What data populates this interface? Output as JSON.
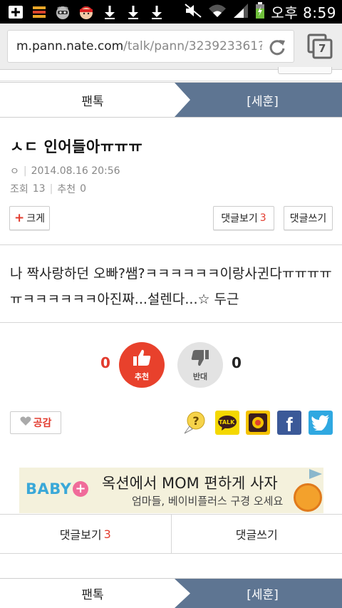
{
  "status_bar": {
    "time": "오후 8:59",
    "icons": [
      "plus-box-icon",
      "stack-icon",
      "raccoon-icon",
      "avatar-icon",
      "download-icon",
      "download-icon",
      "download-icon"
    ]
  },
  "browser": {
    "url_host": "m.pann.nate.com",
    "url_path": "/talk/pann/323923361?cur",
    "tab_count": "7"
  },
  "tabs_top": {
    "left": "팬톡",
    "right": "[세훈]"
  },
  "post": {
    "title": "ㅅㄷ 인어들아ㅠㅠㅠ",
    "author_mark": "ㅇ",
    "date": "2014.08.16 20:56",
    "views_label": "조회",
    "views": "13",
    "recommend_label": "추천",
    "recommend": "0",
    "body": "나 짝사랑하던 오빠?쌤?ㅋㅋㅋㅋㅋㅋ이랑사귄다ㅠㅠㅠㅠㅠㅋㅋㅋㅋㅋㅋ아진짜...설렌다...☆ 두근"
  },
  "buttons": {
    "font_size": "크게",
    "view_comments": "댓글보기",
    "comment_count": "3",
    "write_comment": "댓글쓰기"
  },
  "vote": {
    "up_count": "0",
    "up_label": "추천",
    "down_label": "반대",
    "down_count": "0"
  },
  "empathy": {
    "label": "공감"
  },
  "share": {
    "talk_label": "TALK",
    "facebook_label": "f"
  },
  "ad": {
    "brand_text": "BABY",
    "headline": "옥션에서 MOM 편하게 사자",
    "subline": "엄마들, 베이비플러스 구경 오세요"
  },
  "bottom_bar": {
    "view_comments": "댓글보기",
    "comment_count": "3",
    "write_comment": "댓글쓰기"
  },
  "tabs_bottom": {
    "left": "팬톡",
    "right": "[세훈]"
  },
  "colors": {
    "accent_red": "#e8412c",
    "tab_active": "#5e7592",
    "kakao": "#f4d800",
    "facebook": "#3b5998",
    "twitter": "#2fa8e1"
  }
}
